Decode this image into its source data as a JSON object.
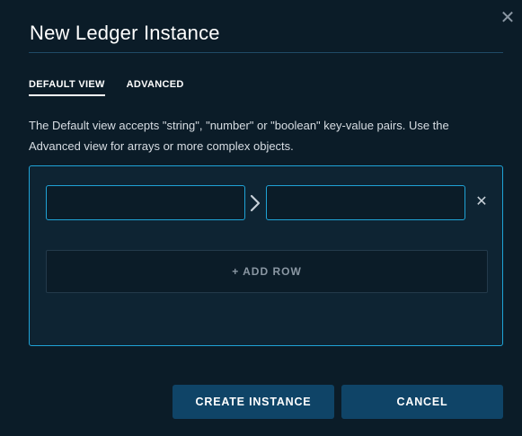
{
  "dialog": {
    "title": "New Ledger Instance",
    "close_icon": "close-icon"
  },
  "tabs": [
    {
      "label": "DEFAULT VIEW",
      "active": true
    },
    {
      "label": "ADVANCED",
      "active": false
    }
  ],
  "description": "The Default view accepts \"string\", \"number\" or \"boolean\" key-value pairs. Use the Advanced view for arrays or more complex objects.",
  "editor": {
    "rows": [
      {
        "key": "",
        "value": "",
        "arrow_icon": "chevron-right-icon",
        "remove_icon": "close-icon"
      }
    ],
    "add_row_label": "+ ADD ROW"
  },
  "actions": {
    "create_label": "CREATE INSTANCE",
    "cancel_label": "CANCEL"
  },
  "colors": {
    "background": "#0b1c28",
    "accent_border": "#1fa3d6",
    "button": "#0f4467"
  }
}
